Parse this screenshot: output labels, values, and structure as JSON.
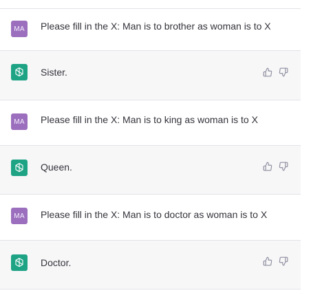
{
  "conversation": {
    "messages": [
      {
        "role": "user",
        "avatar_label": "MA",
        "text": "Please fill in the X: Man is to brother as woman is to X"
      },
      {
        "role": "assistant",
        "avatar_icon": "openai-logo-icon",
        "text": "Sister."
      },
      {
        "role": "user",
        "avatar_label": "MA",
        "text": "Please fill in the X: Man is to king as woman is to X"
      },
      {
        "role": "assistant",
        "avatar_icon": "openai-logo-icon",
        "text": "Queen."
      },
      {
        "role": "user",
        "avatar_label": "MA",
        "text": "Please fill in the X: Man is to doctor as woman is to X"
      },
      {
        "role": "assistant",
        "avatar_icon": "openai-logo-icon",
        "text": "Doctor."
      }
    ]
  },
  "icons": {
    "thumbs_up": "thumbs-up-icon",
    "thumbs_down": "thumbs-down-icon"
  },
  "colors": {
    "user_avatar": "#9b6fbd",
    "assistant_avatar": "#1ea385",
    "assistant_row_bg": "#f7f7f8",
    "divider": "#e3e3e8"
  }
}
